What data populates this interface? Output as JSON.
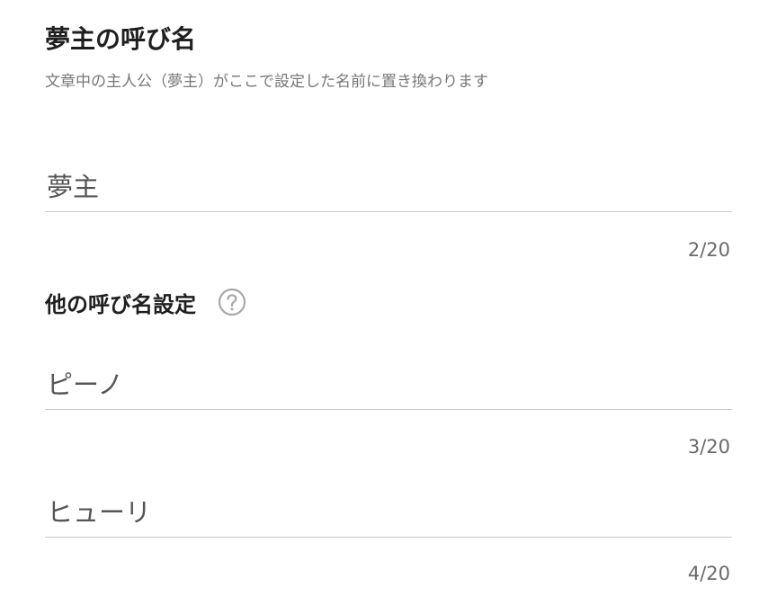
{
  "main_name": {
    "title": "夢主の呼び名",
    "description": "文章中の主人公（夢主）がここで設定した名前に置き換わります",
    "value": "夢主",
    "counter": "2/20"
  },
  "other_names": {
    "title": "他の呼び名設定",
    "help_icon": "question-circle-icon",
    "fields": [
      {
        "value": "ピーノ",
        "counter": "3/20"
      },
      {
        "value": "ヒューリ",
        "counter": "4/20"
      }
    ]
  }
}
